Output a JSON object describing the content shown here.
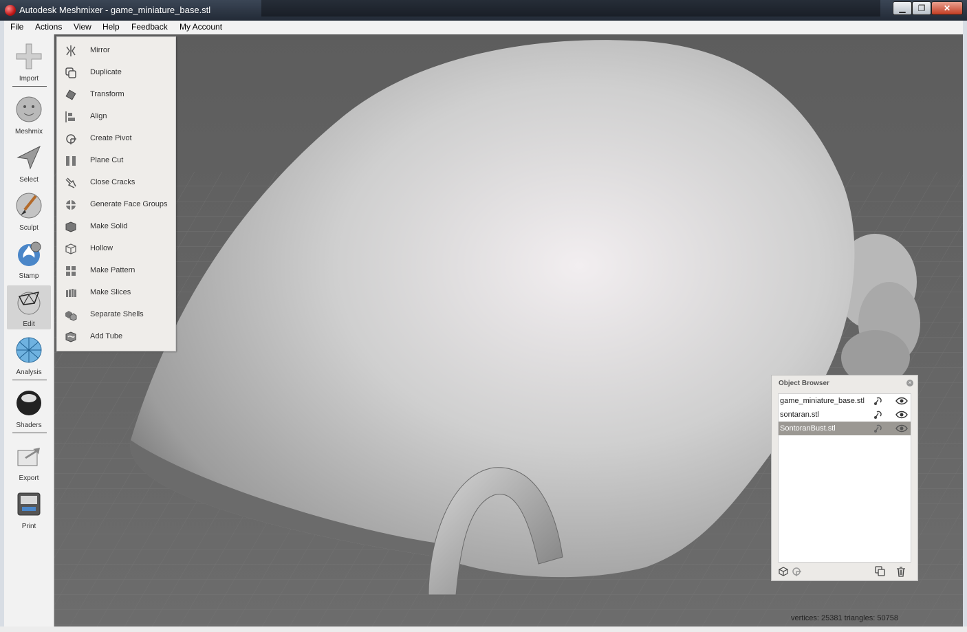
{
  "window": {
    "title": "Autodesk Meshmixer - game_miniature_base.stl",
    "minimize": "▁",
    "maximize": "❐",
    "close": "✕"
  },
  "menu": [
    "File",
    "Actions",
    "View",
    "Help",
    "Feedback",
    "My Account"
  ],
  "toolbar": [
    {
      "label": "Import",
      "icon": "plus-icon"
    },
    {
      "label": "Meshmix",
      "icon": "meshmix-face-icon"
    },
    {
      "label": "Select",
      "icon": "arrow-cursor-icon"
    },
    {
      "label": "Sculpt",
      "icon": "brush-icon"
    },
    {
      "label": "Stamp",
      "icon": "stamp-icon"
    },
    {
      "label": "Edit",
      "icon": "edit-wire-icon",
      "active": true
    },
    {
      "label": "Analysis",
      "icon": "analysis-sphere-icon"
    },
    {
      "label": "Shaders",
      "icon": "shader-ball-icon"
    },
    {
      "label": "Export",
      "icon": "export-icon"
    },
    {
      "label": "Print",
      "icon": "printer-icon"
    }
  ],
  "edit_menu": [
    {
      "label": "Mirror",
      "icon": "mirror-icon"
    },
    {
      "label": "Duplicate",
      "icon": "duplicate-icon"
    },
    {
      "label": "Transform",
      "icon": "transform-icon"
    },
    {
      "label": "Align",
      "icon": "align-icon"
    },
    {
      "label": "Create Pivot",
      "icon": "pivot-icon"
    },
    {
      "label": "Plane Cut",
      "icon": "plane-cut-icon"
    },
    {
      "label": "Close Cracks",
      "icon": "close-cracks-icon"
    },
    {
      "label": "Generate Face Groups",
      "icon": "face-groups-icon"
    },
    {
      "label": "Make Solid",
      "icon": "make-solid-icon"
    },
    {
      "label": "Hollow",
      "icon": "hollow-icon"
    },
    {
      "label": "Make Pattern",
      "icon": "pattern-icon"
    },
    {
      "label": "Make Slices",
      "icon": "slices-icon"
    },
    {
      "label": "Separate Shells",
      "icon": "shells-icon"
    },
    {
      "label": "Add Tube",
      "icon": "tube-icon"
    }
  ],
  "object_browser": {
    "title": "Object Browser",
    "close": "×",
    "objects": [
      {
        "name": "game_miniature_base.stl",
        "selected": false
      },
      {
        "name": "sontaran.stl",
        "selected": false
      },
      {
        "name": "SontoranBust.stl",
        "selected": true
      }
    ]
  },
  "status": "vertices: 25381  triangles: 50758"
}
